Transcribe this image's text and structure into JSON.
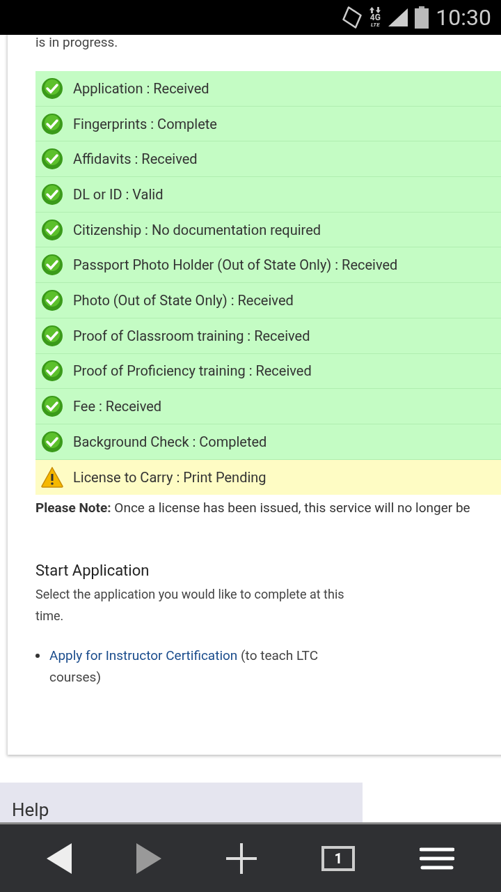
{
  "status_bar": {
    "network": "4G",
    "network_sub": "LTE",
    "time": "10:30"
  },
  "intro_tail": "is in progress.",
  "checklist": [
    {
      "label": "Application : Received",
      "kind": "done"
    },
    {
      "label": "Fingerprints : Complete",
      "kind": "done"
    },
    {
      "label": "Affidavits : Received",
      "kind": "done"
    },
    {
      "label": "DL or ID : Valid",
      "kind": "done"
    },
    {
      "label": "Citizenship : No documentation required",
      "kind": "done"
    },
    {
      "label": "Passport Photo Holder (Out of State Only) : Received",
      "kind": "done"
    },
    {
      "label": "Photo (Out of State Only) : Received",
      "kind": "done"
    },
    {
      "label": "Proof of Classroom training : Received",
      "kind": "done"
    },
    {
      "label": "Proof of Proficiency training : Received",
      "kind": "done"
    },
    {
      "label": "Fee : Received",
      "kind": "done"
    },
    {
      "label": "Background Check : Completed",
      "kind": "done"
    },
    {
      "label": "License to Carry : Print Pending",
      "kind": "pending"
    }
  ],
  "note": "**Please Note:** Once a license has been issued, this service will no longer be",
  "start_application": {
    "heading": "Start Application",
    "text": "Select the application you would like to complete at this time.",
    "items": [
      {
        "link": "Apply for Instructor Certification",
        "suffix": "(to teach LTC courses)"
      }
    ]
  },
  "help_heading": "Help",
  "browser_bar": {
    "tab_count": "1"
  }
}
